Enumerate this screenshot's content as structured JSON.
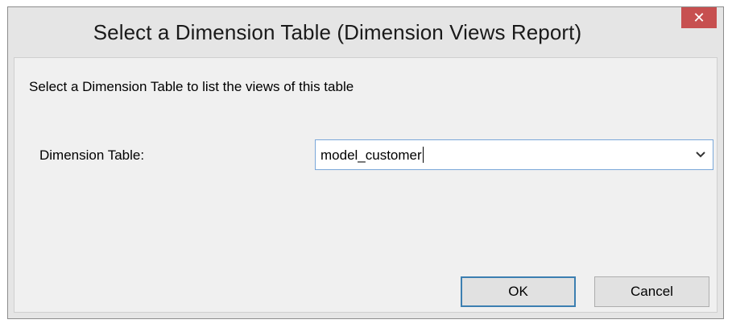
{
  "window": {
    "title": "Select a Dimension Table (Dimension Views Report)",
    "close_glyph": "✕",
    "close_icon": "close-icon"
  },
  "content": {
    "instruction": "Select a Dimension Table to list the views of this table",
    "field_label": "Dimension Table:",
    "combo_value": "model_customer",
    "combo_icon": "chevron-down-icon"
  },
  "buttons": {
    "ok_label": "OK",
    "cancel_label": "Cancel"
  },
  "colors": {
    "close_button": "#c75050",
    "focus_border": "#3c7fb1",
    "chrome": "#e5e5e5",
    "client": "#f0f0f0"
  }
}
